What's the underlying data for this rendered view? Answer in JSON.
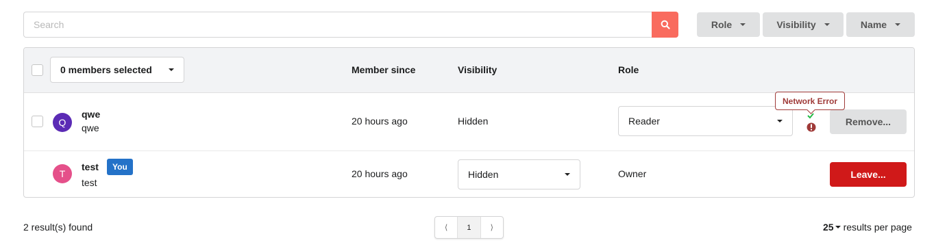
{
  "search": {
    "placeholder": "Search"
  },
  "filters": [
    {
      "label": "Role"
    },
    {
      "label": "Visibility"
    },
    {
      "label": "Name"
    }
  ],
  "table": {
    "select_label": "0 members selected",
    "headers": {
      "member_since": "Member since",
      "visibility": "Visibility",
      "role": "Role"
    },
    "rows": [
      {
        "avatar_letter": "Q",
        "avatar_color": "#5b2bb5",
        "name": "qwe",
        "username": "qwe",
        "member_since": "20 hours ago",
        "visibility": "Hidden",
        "role": "Reader",
        "action": "Remove...",
        "error": "Network Error"
      },
      {
        "avatar_letter": "T",
        "avatar_color": "#e5508a",
        "name": "test",
        "username": "test",
        "badge": "You",
        "member_since": "20 hours ago",
        "visibility": "Hidden",
        "role": "Owner",
        "action": "Leave..."
      }
    ]
  },
  "footer": {
    "results": "2 result(s) found",
    "pages": [
      "⟨",
      "1",
      "⟩"
    ],
    "per_page_value": "25",
    "per_page_label": "results per page"
  },
  "colors": {
    "accent": "#f96b5e",
    "danger": "#d01919",
    "badge": "#2472c8",
    "error": "#9f3a38"
  }
}
